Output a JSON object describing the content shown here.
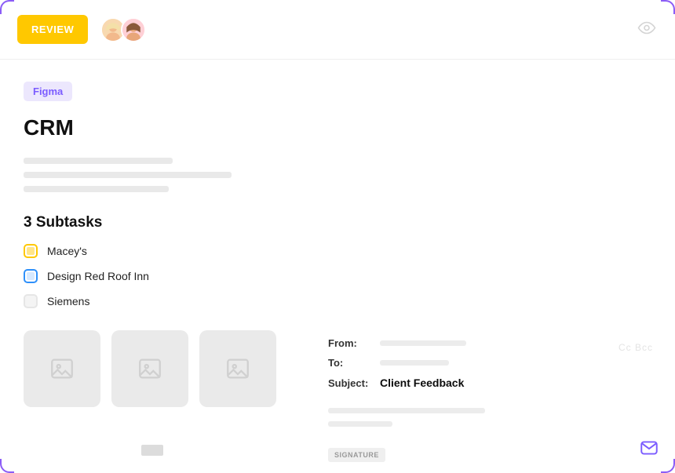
{
  "header": {
    "review_label": "REVIEW"
  },
  "tag": {
    "label": "Figma"
  },
  "title": "CRM",
  "subtasks": {
    "heading": "3 Subtasks",
    "items": [
      {
        "label": "Macey's",
        "color": "yellow"
      },
      {
        "label": "Design Red Roof Inn",
        "color": "blue"
      },
      {
        "label": "Siemens",
        "color": "gray"
      }
    ]
  },
  "email": {
    "from_label": "From:",
    "to_label": "To:",
    "subject_label": "Subject:",
    "subject_value": "Client Feedback",
    "cc_bcc": "Cc Bcc",
    "signature_chip": "SIGNATURE"
  }
}
